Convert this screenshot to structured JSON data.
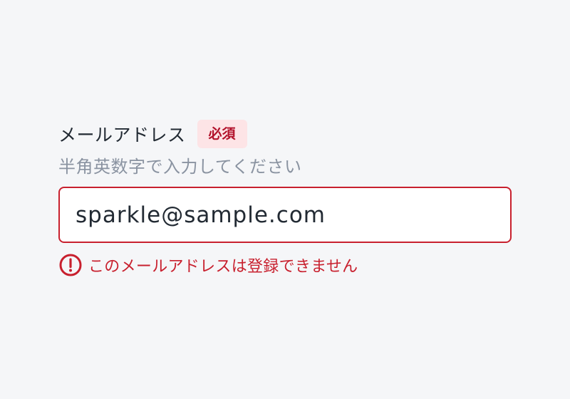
{
  "field": {
    "label": "メールアドレス",
    "required_badge": "必須",
    "hint": "半角英数字で入力してください",
    "value": "sparkle@sample.com",
    "error_message": "このメールアドレスは登録できません",
    "error_icon": "alert-circle-icon"
  },
  "colors": {
    "background": "#f5f6f8",
    "error": "#c8202e",
    "badge_bg": "#fde4e6",
    "badge_text": "#b2122b",
    "text": "#222a33",
    "hint": "#8a93a1"
  }
}
